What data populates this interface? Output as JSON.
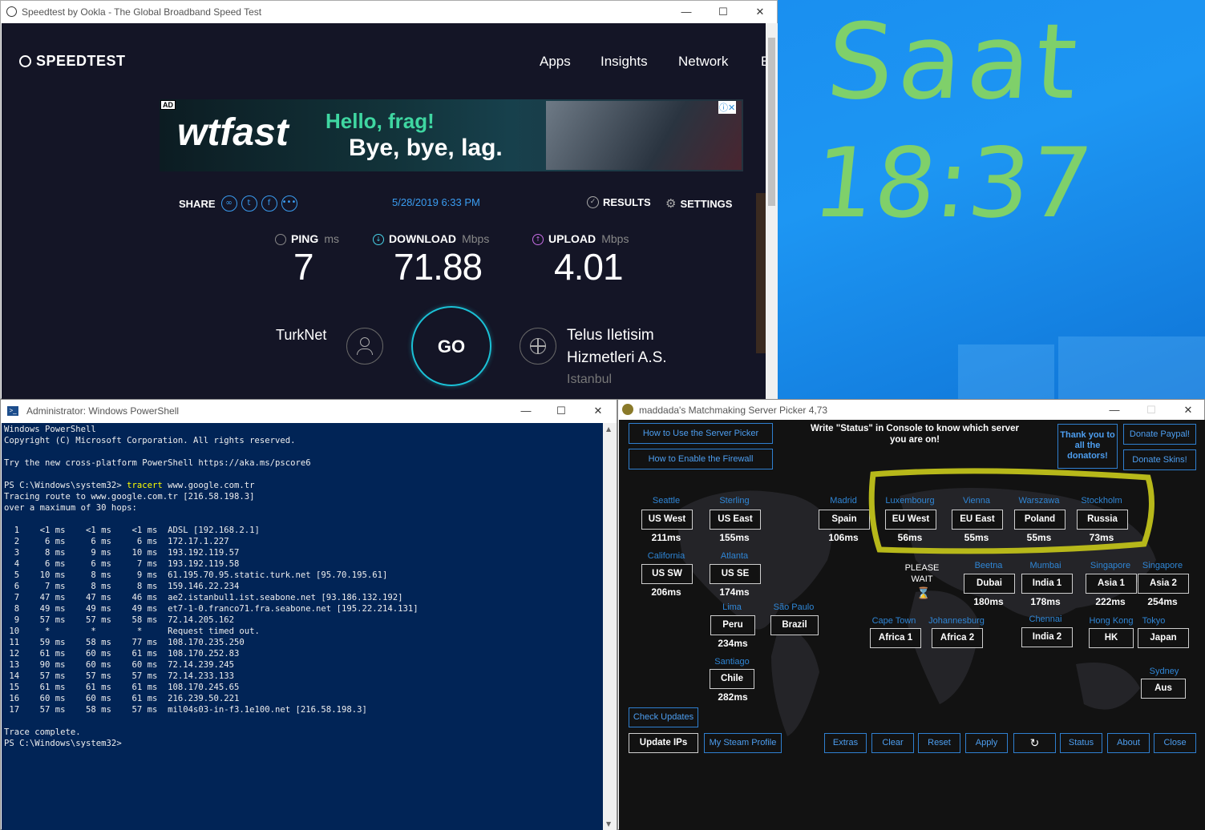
{
  "desktop": {
    "clock_label": "Saat",
    "clock_time": "18:37"
  },
  "speedtest": {
    "window_title": "Speedtest by Ookla - The Global Broadband Speed Test",
    "logo": "SPEEDTEST",
    "nav": [
      "Apps",
      "Insights",
      "Network",
      "E"
    ],
    "ad": {
      "badge": "AD",
      "brand": "wtfast",
      "line1": "Hello, frag!",
      "line2": "Bye, bye, lag."
    },
    "share_label": "SHARE",
    "datetime": "5/28/2019 6:33 PM",
    "results_label": "RESULTS",
    "settings_label": "SETTINGS",
    "ping": {
      "label": "PING",
      "unit": "ms",
      "value": "7"
    },
    "download": {
      "label": "DOWNLOAD",
      "unit": "Mbps",
      "value": "71.88"
    },
    "upload": {
      "label": "UPLOAD",
      "unit": "Mbps",
      "value": "4.01"
    },
    "isp": "TurkNet",
    "go_label": "GO",
    "server_name_1": "Telus Iletisim",
    "server_name_2": "Hizmetleri A.S.",
    "server_city": "Istanbul"
  },
  "powershell": {
    "window_title": "Administrator: Windows PowerShell",
    "lines_before": "Windows PowerShell\nCopyright (C) Microsoft Corporation. All rights reserved.\n\nTry the new cross-platform PowerShell https://aka.ms/pscore6\n",
    "prompt": "PS C:\\Windows\\system32> ",
    "command": "tracert",
    "command_arg": " www.google.com.tr",
    "output": "\nTracing route to www.google.com.tr [216.58.198.3]\nover a maximum of 30 hops:\n\n  1    <1 ms    <1 ms    <1 ms  ADSL [192.168.2.1]\n  2     6 ms     6 ms     6 ms  172.17.1.227\n  3     8 ms     9 ms    10 ms  193.192.119.57\n  4     6 ms     6 ms     7 ms  193.192.119.58\n  5    10 ms     8 ms     9 ms  61.195.70.95.static.turk.net [95.70.195.61]\n  6     7 ms     8 ms     8 ms  159.146.22.234\n  7    47 ms    47 ms    46 ms  ae2.istanbul1.ist.seabone.net [93.186.132.192]\n  8    49 ms    49 ms    49 ms  et7-1-0.franco71.fra.seabone.net [195.22.214.131]\n  9    57 ms    57 ms    58 ms  72.14.205.162\n 10     *        *        *     Request timed out.\n 11    59 ms    58 ms    77 ms  108.170.235.250\n 12    61 ms    60 ms    61 ms  108.170.252.83\n 13    90 ms    60 ms    60 ms  72.14.239.245\n 14    57 ms    57 ms    57 ms  72.14.233.133\n 15    61 ms    61 ms    61 ms  108.170.245.65\n 16    60 ms    60 ms    61 ms  216.239.50.221\n 17    57 ms    58 ms    57 ms  mil04s03-in-f3.1e100.net [216.58.198.3]\n\nTrace complete.\nPS C:\\Windows\\system32>"
  },
  "picker": {
    "window_title": "maddada's Matchmaking Server Picker 4,73",
    "how_use": "How to Use the Server Picker",
    "how_firewall": "How to Enable the Firewall",
    "status_hint": "Write \"Status\" in Console to know which server you are on!",
    "thanks": "Thank you to all the donators!",
    "donate_paypal": "Donate Paypal!",
    "donate_skins": "Donate Skins!",
    "please_wait": "PLEASE WAIT",
    "servers": [
      {
        "city": "Seattle",
        "name": "US West",
        "ping": "211ms"
      },
      {
        "city": "Sterling",
        "name": "US East",
        "ping": "155ms"
      },
      {
        "city": "Madrid",
        "name": "Spain",
        "ping": "106ms"
      },
      {
        "city": "Luxembourg",
        "name": "EU West",
        "ping": "56ms"
      },
      {
        "city": "Vienna",
        "name": "EU East",
        "ping": "55ms"
      },
      {
        "city": "Warszawa",
        "name": "Poland",
        "ping": "55ms"
      },
      {
        "city": "Stockholm",
        "name": "Russia",
        "ping": "73ms"
      },
      {
        "city": "California",
        "name": "US SW",
        "ping": "206ms"
      },
      {
        "city": "Atlanta",
        "name": "US SE",
        "ping": "174ms"
      },
      {
        "city": "Beetna",
        "name": "Dubai",
        "ping": "180ms"
      },
      {
        "city": "Mumbai",
        "name": "India 1",
        "ping": "178ms"
      },
      {
        "city": "Singapore",
        "name": "Asia 1",
        "ping": "222ms"
      },
      {
        "city": "Singapore",
        "name": "Asia 2",
        "ping": "254ms"
      },
      {
        "city": "Lima",
        "name": "Peru",
        "ping": "234ms"
      },
      {
        "city": "São Paulo",
        "name": "Brazil",
        "ping": ""
      },
      {
        "city": "Cape Town",
        "name": "Africa 1",
        "ping": ""
      },
      {
        "city": "Johannesburg",
        "name": "Africa 2",
        "ping": ""
      },
      {
        "city": "Chennai",
        "name": "India 2",
        "ping": ""
      },
      {
        "city": "Hong Kong",
        "name": "HK",
        "ping": ""
      },
      {
        "city": "Tokyo",
        "name": "Japan",
        "ping": ""
      },
      {
        "city": "Santiago",
        "name": "Chile",
        "ping": "282ms"
      },
      {
        "city": "Sydney",
        "name": "Aus",
        "ping": ""
      }
    ],
    "check_updates": "Check Updates",
    "update_ips": "Update IPs",
    "steam_profile": "My Steam Profile",
    "bottom": [
      "Extras",
      "Clear",
      "Reset",
      "Apply",
      "Status",
      "About",
      "Close"
    ],
    "highlight_color": "#b7b81a"
  }
}
